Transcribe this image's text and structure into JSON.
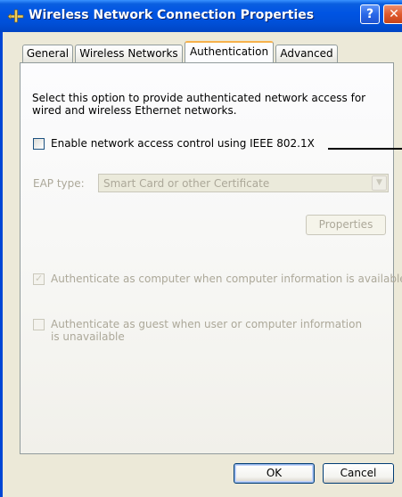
{
  "window": {
    "title": "Wireless Network Connection Properties",
    "help_label": "?",
    "close_label": "✕",
    "icon": "network-connection-icon"
  },
  "tabs": [
    {
      "label": "General",
      "active": false
    },
    {
      "label": "Wireless Networks",
      "active": false
    },
    {
      "label": "Authentication",
      "active": true
    },
    {
      "label": "Advanced",
      "active": false
    }
  ],
  "auth": {
    "description": "Select this option to provide authenticated network access for wired and wireless Ethernet networks.",
    "enable_8021x": {
      "label": "Enable network access control using IEEE 802.1X",
      "checked": false
    },
    "eap_type_label": "EAP type:",
    "eap_type_value": "Smart Card or other Certificate",
    "properties_label": "Properties",
    "auth_computer": {
      "label": "Authenticate as computer when computer information is available",
      "checked": true,
      "check_glyph": "✓"
    },
    "auth_guest": {
      "label": "Authenticate as guest when user or computer information is unavailable",
      "checked": false
    }
  },
  "footer": {
    "ok_label": "OK",
    "cancel_label": "Cancel"
  },
  "colors": {
    "titlebar": "#0054e3",
    "active_tab_highlight": "#f6b14c",
    "disabled_text": "#aca899"
  }
}
